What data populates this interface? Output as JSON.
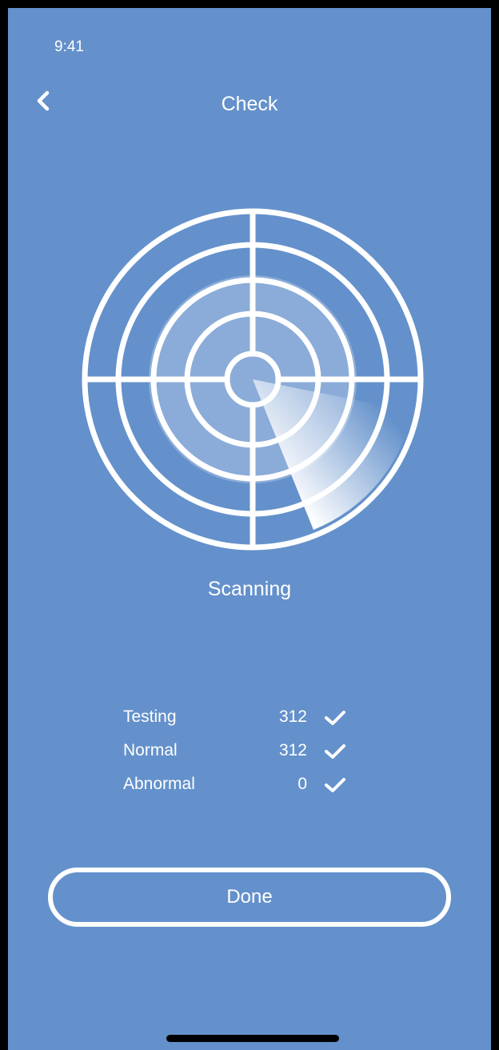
{
  "status_bar": {
    "time": "9:41"
  },
  "nav": {
    "back_icon": "chevron-left-icon",
    "title": "Check"
  },
  "radar": {
    "icon": "radar-icon",
    "status": "Scanning"
  },
  "stats": [
    {
      "label": "Testing",
      "value": "312",
      "icon": "checkmark-icon"
    },
    {
      "label": "Normal",
      "value": "312",
      "icon": "checkmark-icon"
    },
    {
      "label": "Abnormal",
      "value": "0",
      "icon": "checkmark-icon"
    }
  ],
  "actions": {
    "done_label": "Done"
  },
  "colors": {
    "background": "#6491cb",
    "foreground": "#ffffff",
    "frame": "#000000"
  }
}
